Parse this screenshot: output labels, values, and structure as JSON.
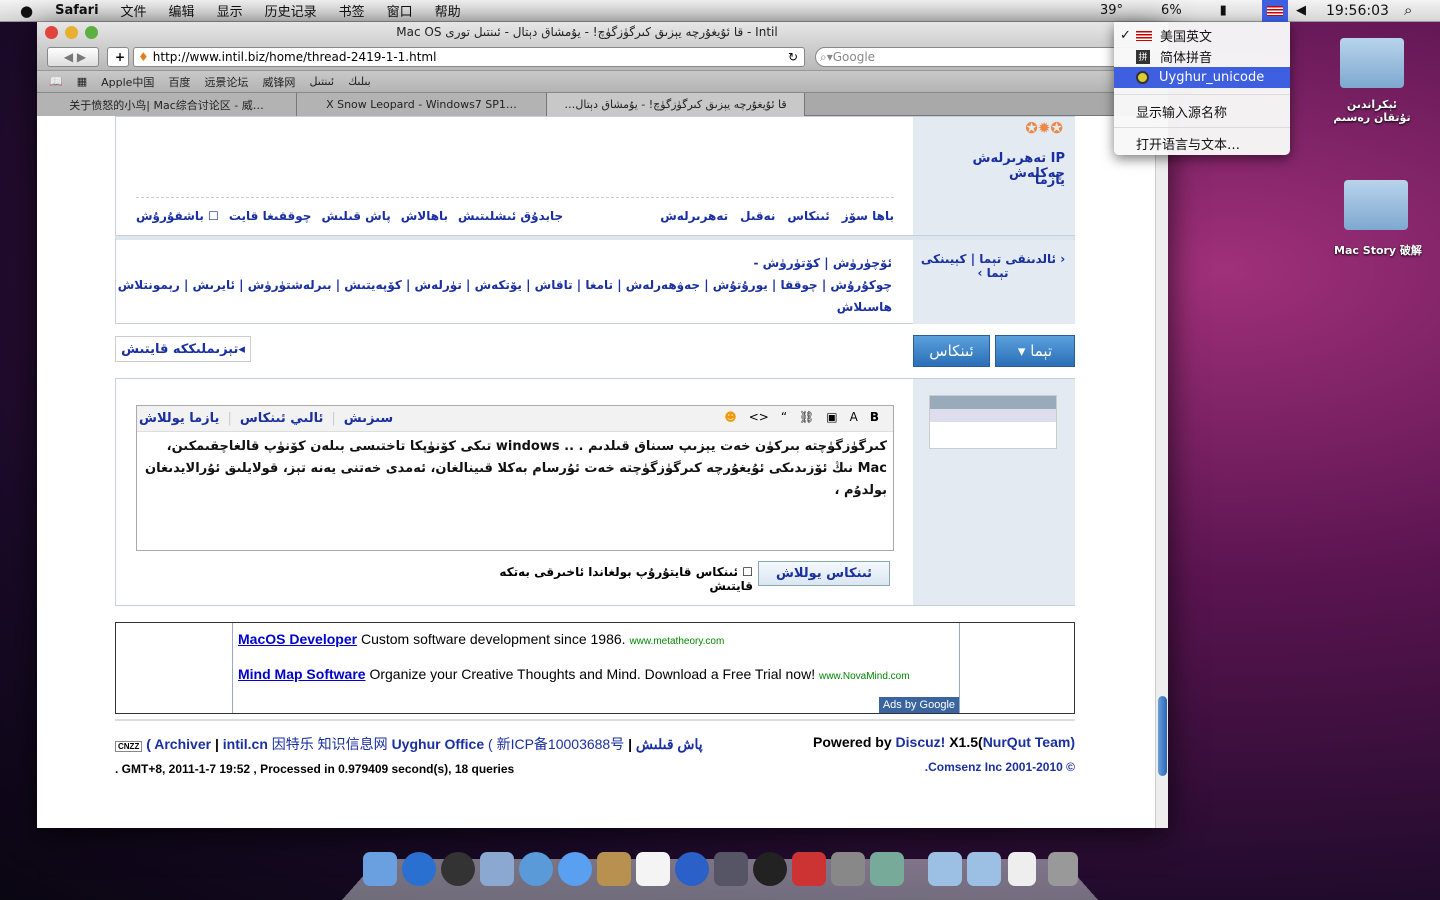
{
  "menubar": {
    "app": "Safari",
    "items": [
      "文件",
      "编辑",
      "显示",
      "历史记录",
      "书签",
      "窗口",
      "帮助"
    ],
    "temp": "39°",
    "cpu": "6%",
    "clock": "19:56:03"
  },
  "input_menu": {
    "items": [
      {
        "label": "美国英文",
        "checked": true
      },
      {
        "label": "简体拼音"
      },
      {
        "label": "Uyghur_unicode",
        "highlighted": true
      }
    ],
    "show_names": "显示输入源名称",
    "open_prefs": "打开语言与文本…"
  },
  "window": {
    "title": "Intil - قا ئۇيغۇرچە يېزىق كىرگۈزگۈچ! - يۇمشاق دېتال - ئىنتىل تورى Mac OS",
    "url": "http://www.intil.biz/home/thread-2419-1-1.html",
    "search_placeholder": "Google",
    "bookmarks": [
      "Apple中国",
      "百度",
      "远景论坛",
      "威锋网",
      "ئىنتىل",
      "بىلىك"
    ],
    "tabs": [
      "关于愤怒的小鸟| Mac综合讨论区 - 威…",
      "X Snow Leopard - Windows7 SP1…",
      "قا ئۇيغۇرچە يېزىق كىرگۈزگۈچ! - يۇمشاق دېتال…"
    ]
  },
  "post": {
    "sidebar_link": "IP تەھرىرلەش چەكلەش",
    "sidebar_link2": "يازما",
    "actions_right": [
      "باھا سۆز",
      "ئىنكاس",
      "نەقىل",
      "تەھرىرلەش"
    ],
    "actions_left": [
      "جابدۇق ئىشلىتىش",
      "باھالاش",
      "پاش قىلىش",
      "چوققىغا قايت",
      "باشقۇرۇش"
    ],
    "nav_prev": "‹ ئالدىنقى تېما",
    "nav_next": "كېيىنكى تېما ›",
    "mod_line1": "ئۆچۈرۈش | كۆتۈرۈش -",
    "mod_line2": "چوكۇرۇش | چوققا | يورۇتۇش | جەۋھەرلەش | تامغا | تاقاش | يۆتكەش | تۈرلەش | كۆپەيتىش | بىرلەشتۈرۈش | ئايرىش | رېمونتلاش | ئاگاھلاندۇرۇش | تو",
    "mod_line3": "ھاسىلاش",
    "btn_new": "تېما",
    "btn_reply": "ئىنكاس",
    "search_link": "تېزىملىككە قايتىش"
  },
  "editor": {
    "tabs": [
      "سىزىش",
      "ئالىي ئىنكاس",
      "يازما يوللاش"
    ],
    "text": "كىرگۈزگۈچتە بىركۈن خەت يېزىپ سىناق قىلدىم . .. windows تىكى كۆنۈپكا تاختىسى بىلەن كۆنۈپ قالغاچقىمكىن، Mac نىڭ ئۆزىدىكى ئۇيغۇرچە كىرگۈزگۈچتە خەت ئۇرسام بەكلا قىينالغان، ئەمدى خەتنى يەنە تېز، قولايلىق ئۇرالايدىغان بولدۇم ،",
    "submit": "ئىنكاس يوللاش",
    "checkbox_label": "ئىنكاس قايتۇرۇپ بولغاندا ئاخىرقى بەتكە قايتىش"
  },
  "ads": [
    {
      "title": "MacOS Developer",
      "text": "Custom software development since 1986.",
      "url": "www.metatheory.com"
    },
    {
      "title": "Mind Map Software",
      "text": "Organize your Creative Thoughts and Mind. Download a Free Trial now!",
      "url": "www.NovaMind.com"
    }
  ],
  "ads_by": "Ads by Google",
  "footer": {
    "archiver": "( Archiver",
    "site": "intil.cn",
    "cn1": "因特乐 知识信息网",
    "office": "Uyghur Office",
    "icp": "( 新ICP备10003688号",
    "report": "پاش قىلىش",
    "powered": "Powered by",
    "discuz": "Discuz!",
    "version": "X1.5(",
    "team": "NurQut Team)",
    "stats": ". GMT+8, 2011-1-7 19:52 , Processed in 0.979409 second(s), 18 queries",
    "copy": ".Comsenz Inc 2001-2010 ©"
  },
  "desktop": {
    "folder1": "ئېكراندىن تۇتقان رەسىم",
    "folder2": "Mac Story 破解"
  },
  "colors": {
    "link": "#1a2fa0",
    "sidebar": "#e3eaf2",
    "highlight": "#3d5fe0"
  }
}
